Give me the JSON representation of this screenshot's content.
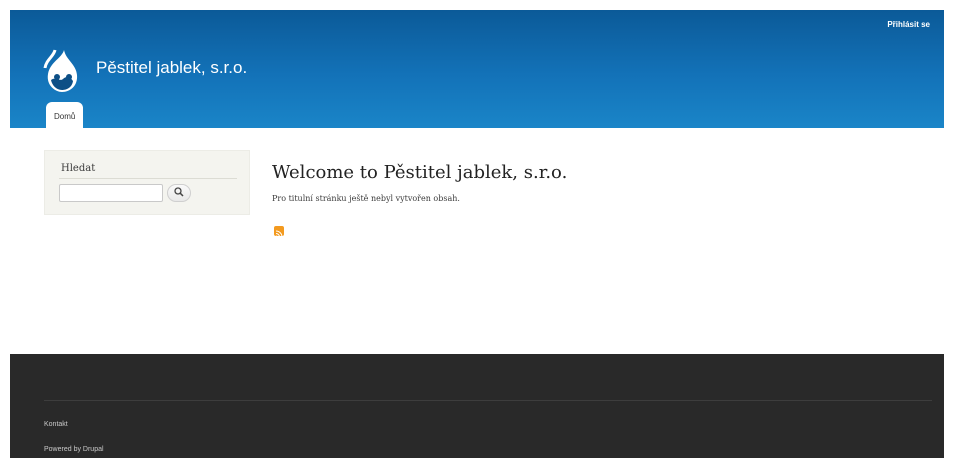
{
  "header": {
    "login_label": "Přihlásit se",
    "site_name": "Pěstitel jablek, s.r.o.",
    "logo_icon": "drupal-drop-icon",
    "tabs": [
      {
        "label": "Domů",
        "active": true
      }
    ],
    "gradient_top": "#0b5a98",
    "gradient_bottom": "#1a85c8"
  },
  "sidebar": {
    "search_title": "Hledat",
    "search_value": "",
    "search_icon": "search-icon"
  },
  "main": {
    "title": "Welcome to Pěstitel jablek, s.r.o.",
    "text": "Pro titulní stránku ještě nebyl vytvořen obsah.",
    "feed_icon": "rss-icon",
    "feed_color": "#f39a1f"
  },
  "footer": {
    "contact_label": "Kontakt",
    "powered_label": "Powered by Drupal",
    "background": "#292929"
  }
}
